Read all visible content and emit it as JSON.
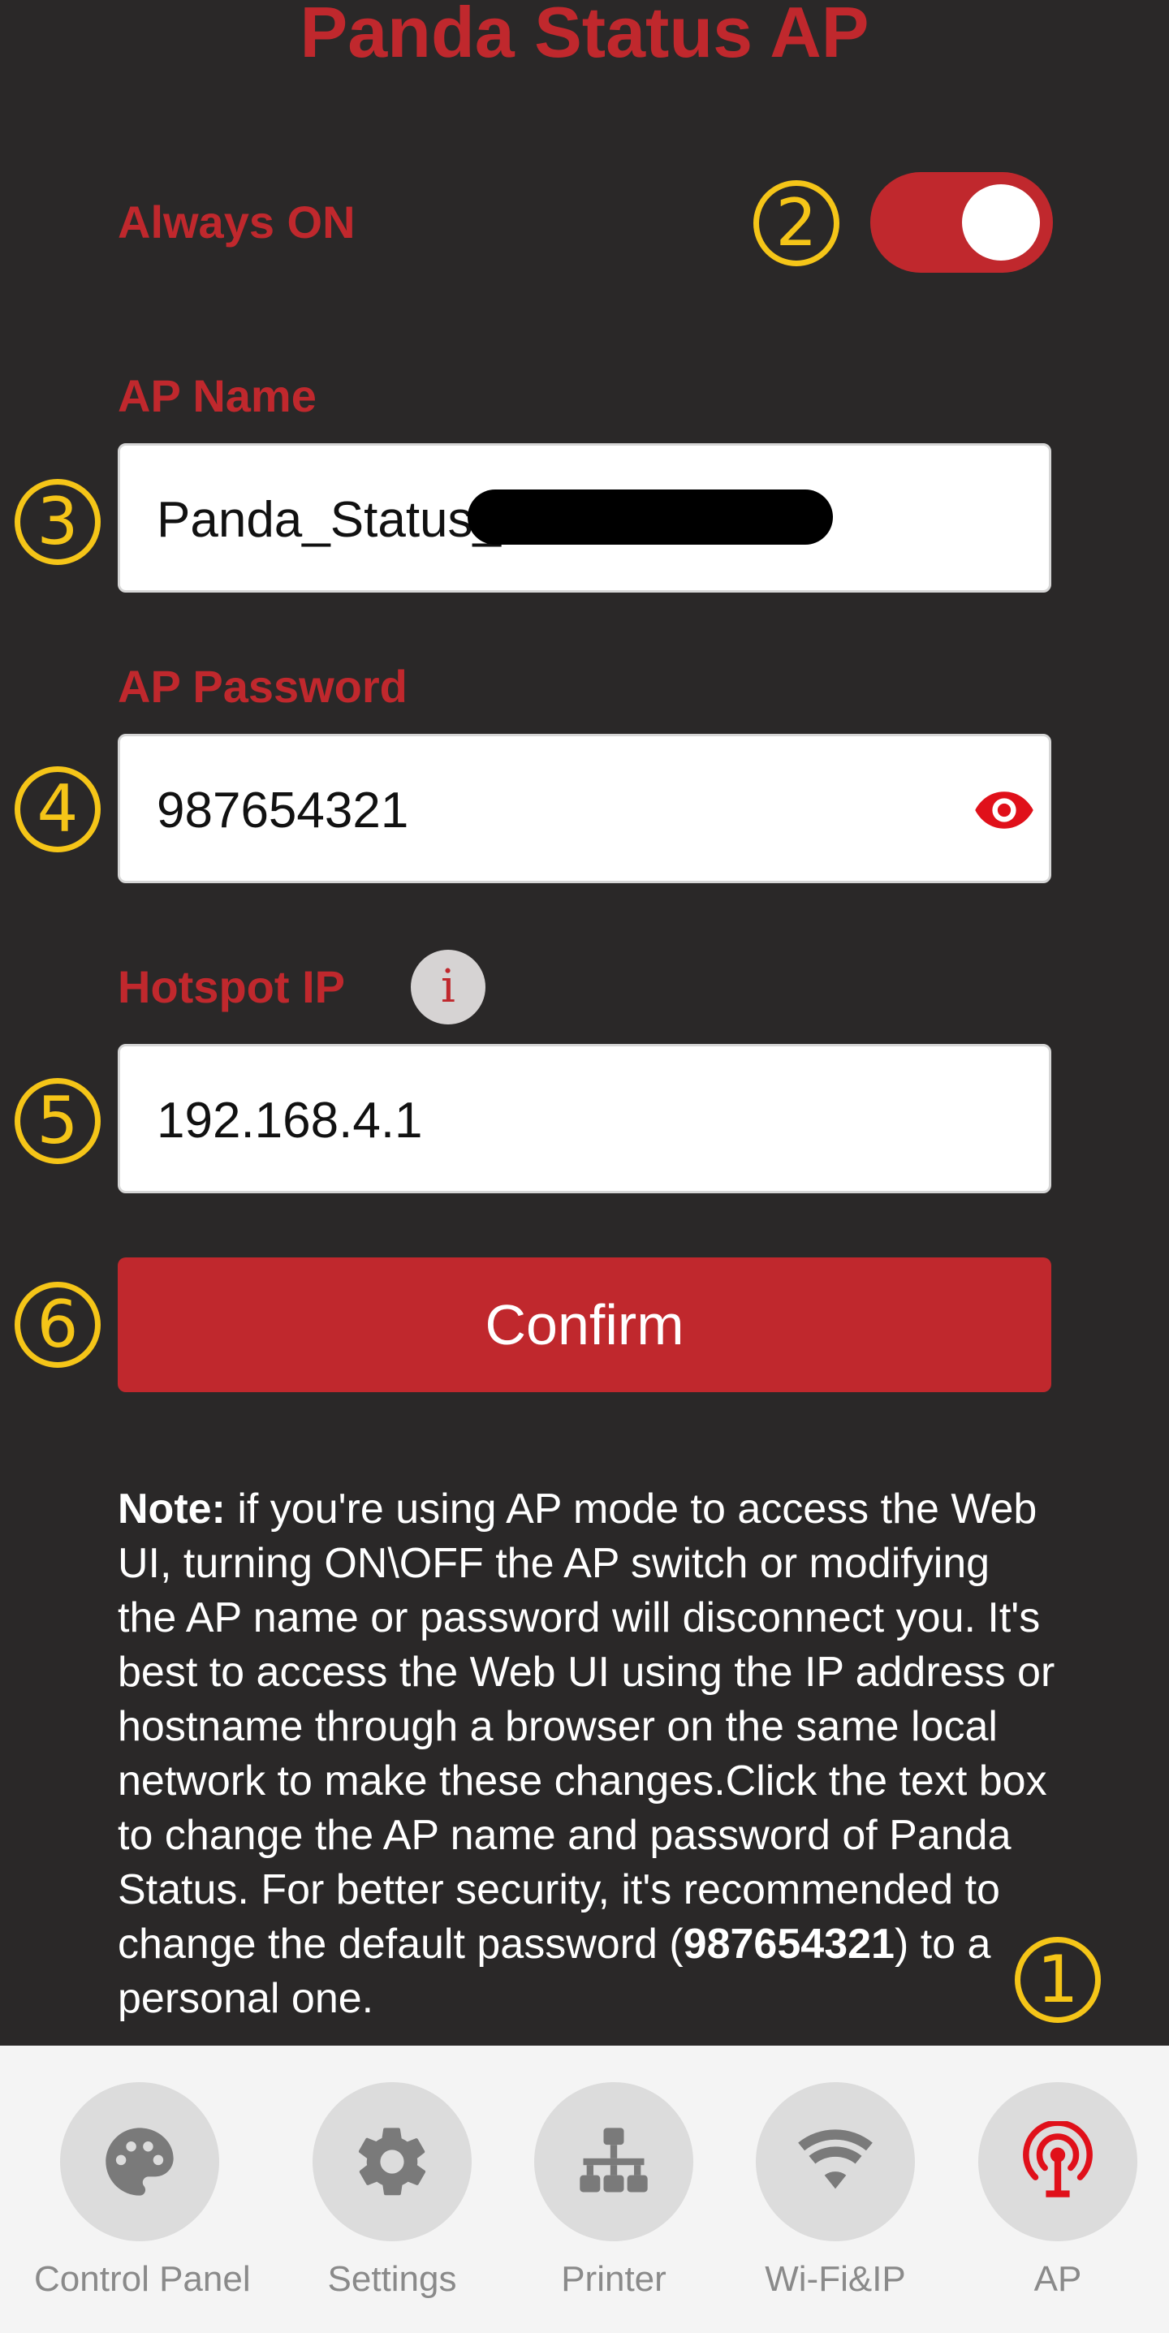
{
  "header": {
    "title": "Panda Status AP"
  },
  "always_on": {
    "label": "Always ON",
    "state": "on"
  },
  "ap_name": {
    "label": "AP Name",
    "value": "Panda_Status_"
  },
  "ap_password": {
    "label": "AP Password",
    "value": "987654321"
  },
  "hotspot_ip": {
    "label": "Hotspot IP",
    "value": "192.168.4.1",
    "info_glyph": "i"
  },
  "confirm": {
    "label": "Confirm"
  },
  "note": {
    "bold_prefix": "Note:",
    "text_1": " if you're using AP mode to access the Web UI, turning ON\\OFF the AP switch or modifying the AP name or password will disconnect you. It's best to access the Web UI using the IP address or hostname through a browser on the same local network to make these changes.Click the text box to change the AP name and password of Panda Status. For better security, it's recommended to change the default password (",
    "bold_password": "987654321",
    "text_2": ") to a personal one."
  },
  "markers": {
    "m1": "1",
    "m2": "2",
    "m3": "3",
    "m4": "4",
    "m5": "5",
    "m6": "6"
  },
  "nav": {
    "items": [
      {
        "label": "Control Panel",
        "icon": "palette-icon"
      },
      {
        "label": "Settings",
        "icon": "gear-icon"
      },
      {
        "label": "Printer",
        "icon": "network-icon"
      },
      {
        "label": "Wi-Fi&IP",
        "icon": "wifi-icon"
      },
      {
        "label": "AP",
        "icon": "antenna-icon",
        "active": true
      }
    ]
  },
  "colors": {
    "accent": "#c0282d",
    "background": "#2a2828",
    "marker": "#f5c518",
    "nav_bg": "#f4f4f4",
    "nav_circle": "#dcdcdc",
    "nav_icon": "#7a7a7a"
  }
}
